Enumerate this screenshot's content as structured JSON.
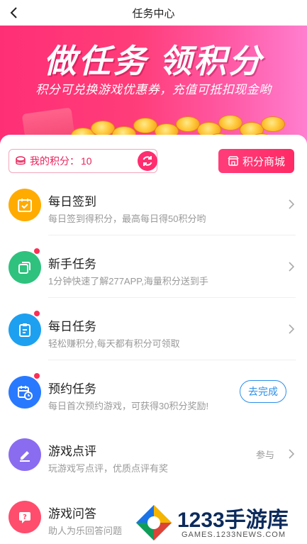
{
  "header": {
    "title": "任务中心"
  },
  "banner": {
    "headline": "做任务 领积分",
    "subtitle": "积分可兑换游戏优惠券，充值可抵扣现金哟"
  },
  "points": {
    "label": "我的积分：",
    "value": "10"
  },
  "mall_button": {
    "label": "积分商城"
  },
  "tasks": [
    {
      "name": "每日签到",
      "desc": "每日签到得积分，最高每日得50积分哟",
      "icon": "calendar-check-icon",
      "color": "#ffab00"
    },
    {
      "name": "新手任务",
      "desc": "1分钟快速了解277APP,海量积分送到手",
      "icon": "cards-icon",
      "color": "#2ec27e"
    },
    {
      "name": "每日任务",
      "desc": "轻松赚积分,每天都有积分可领取",
      "icon": "clipboard-icon",
      "color": "#1ea0f0"
    },
    {
      "name": "预约任务",
      "desc": "每日首次预约游戏，可获得30积分奖励!",
      "icon": "calendar-clock-icon",
      "color": "#2979ff",
      "action": "去完成"
    },
    {
      "name": "游戏点评",
      "desc": "玩游戏写点评，优质点评有奖",
      "icon": "pen-icon",
      "color": "#8a6cf0",
      "side": "参与"
    },
    {
      "name": "游戏问答",
      "desc": "助人为乐回答问题",
      "icon": "question-chat-icon",
      "color": "#ff4d6d"
    }
  ],
  "watermark": {
    "brand": "1233手游库",
    "url": "GAMES.1233NEWS.COM"
  },
  "colors": {
    "accent": "#ff2d6f",
    "link_blue": "#2a8fe8",
    "muted": "#999999"
  }
}
